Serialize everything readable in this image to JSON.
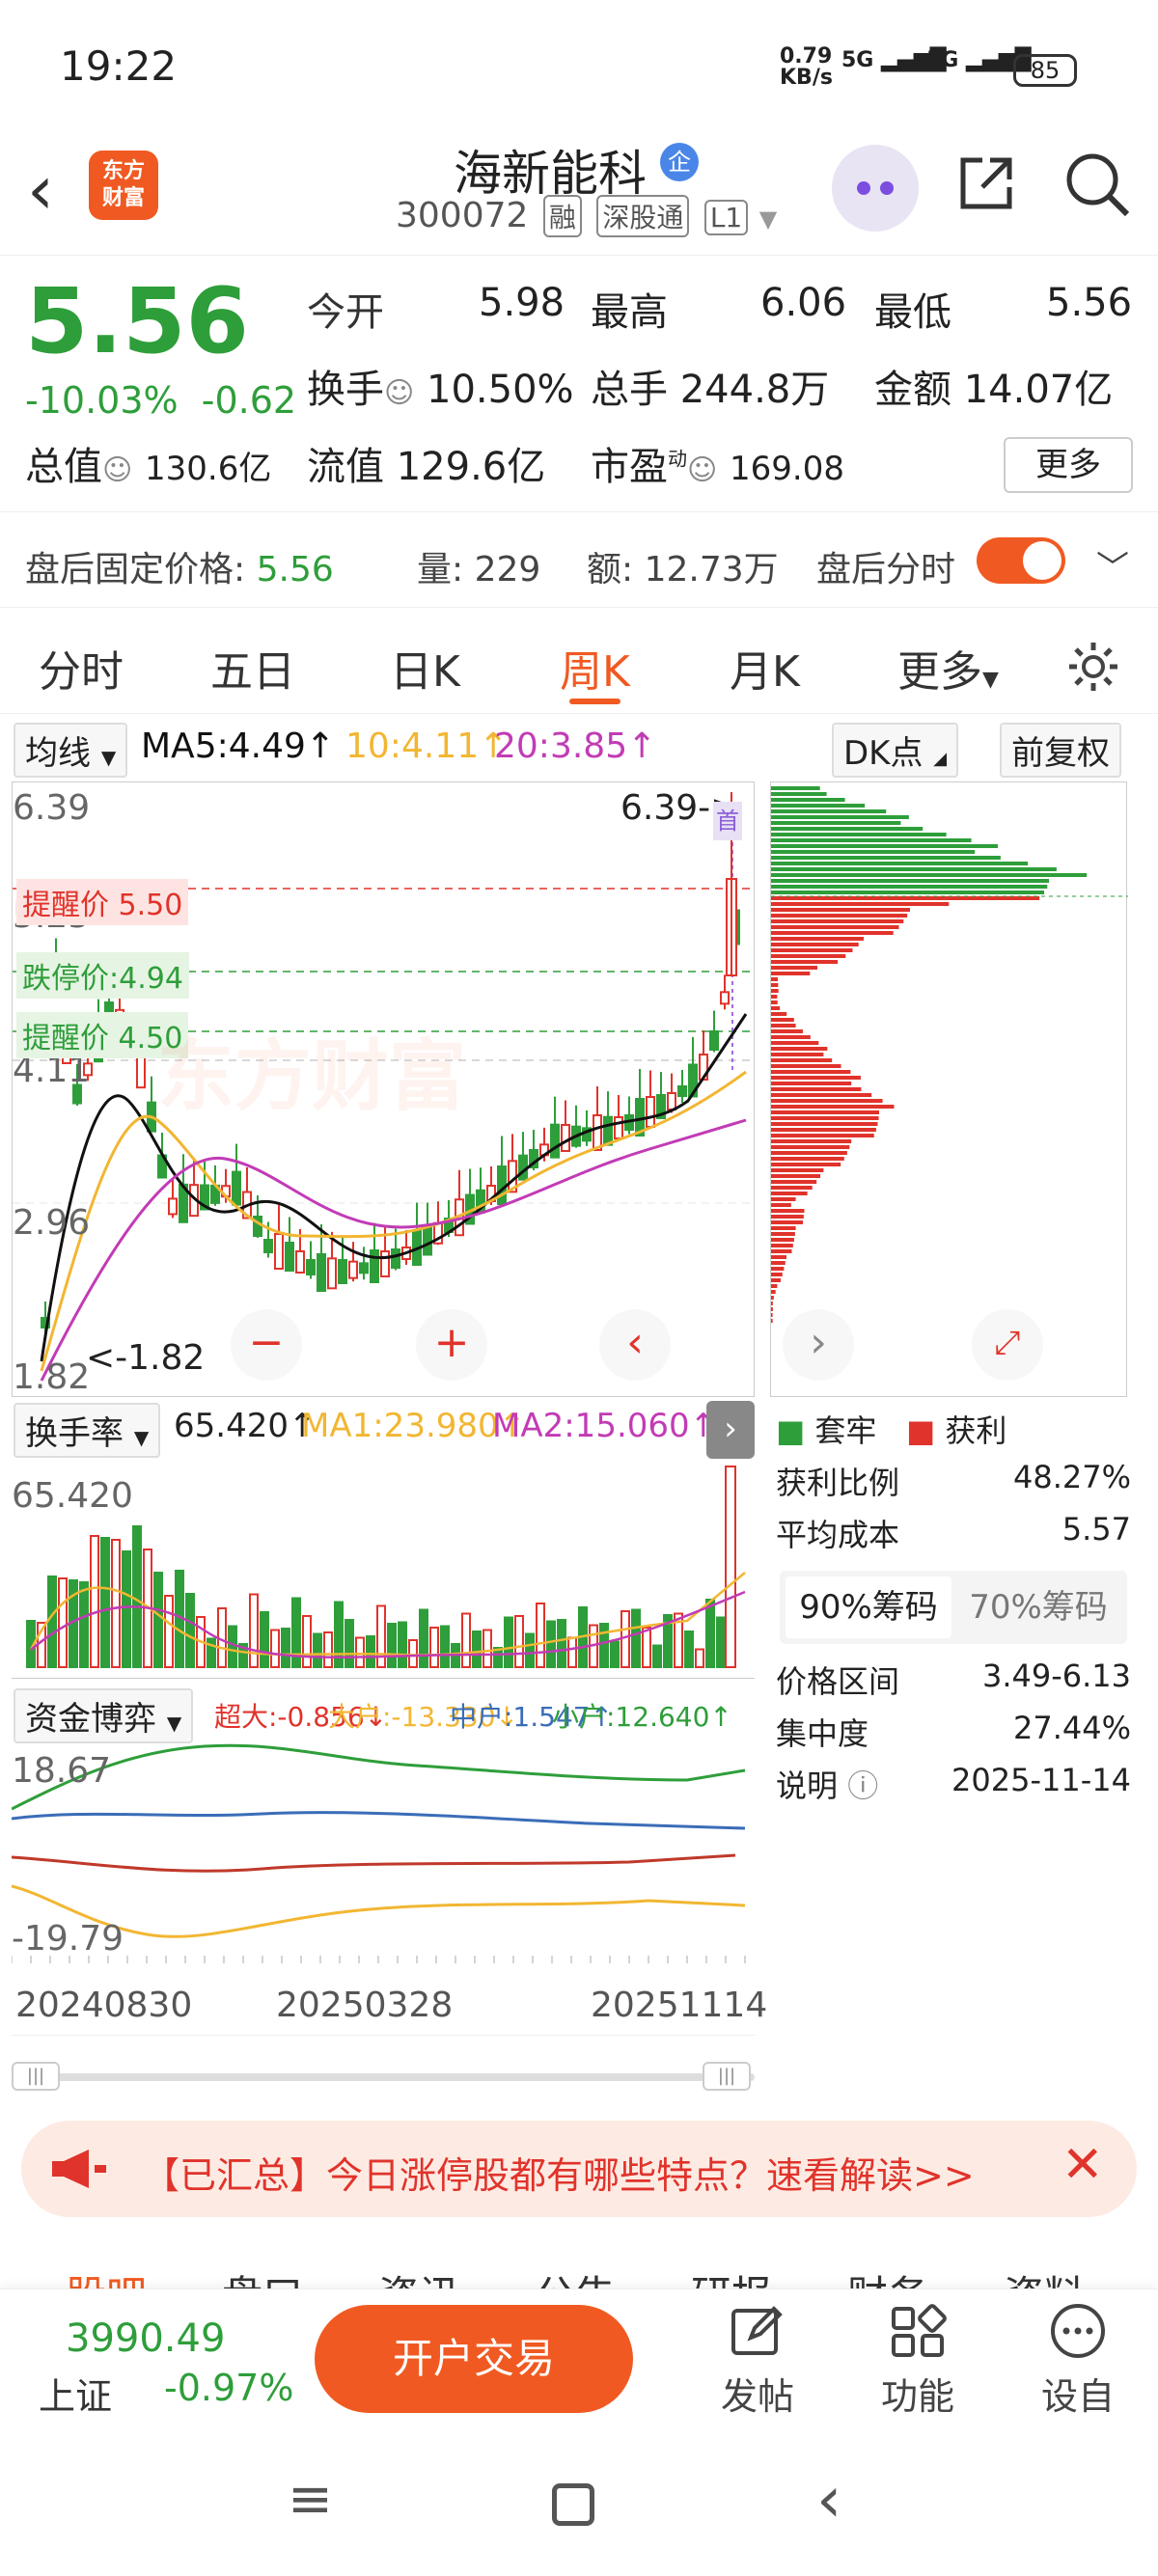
{
  "status": {
    "time": "19:22",
    "net_speed": "0.79",
    "net_unit": "KB/s",
    "sig1": "5G",
    "sig2": "5G",
    "battery": "85"
  },
  "header": {
    "logo_line1": "东方",
    "logo_line2": "财富",
    "stock_name": "海新能科",
    "cert_badge": "企",
    "code": "300072",
    "tags": [
      "融",
      "深股通",
      "L1"
    ]
  },
  "quote": {
    "price": "5.56",
    "pct": "-10.03%",
    "chg": "-0.62",
    "open_label": "今开",
    "open": "5.98",
    "high_label": "最高",
    "high": "6.06",
    "low_label": "最低",
    "low": "5.56",
    "turnover_label": "换手",
    "turnover": "10.50%",
    "volume_label": "总手",
    "volume": "244.8万",
    "amount_label": "金额",
    "amount": "14.07亿",
    "mktcap_label": "总值",
    "mktcap": "130.6亿",
    "float_label": "流值",
    "float": "129.6亿",
    "pe_label": "市盈",
    "pe_sup": "动",
    "pe": "169.08",
    "more": "更多"
  },
  "after_hours": {
    "label": "盘后固定价格:",
    "price": "5.56",
    "vol_label": "量:",
    "vol": "229",
    "amt_label": "额:",
    "amt": "12.73万",
    "timeshare": "盘后分时"
  },
  "period_tabs": [
    "分时",
    "五日",
    "日K",
    "周K",
    "月K",
    "更多"
  ],
  "ma_bar": {
    "select": "均线",
    "ma5": "MA5:4.49",
    "ma10": "10:4.11",
    "ma20": "20:3.85",
    "dk": "DK点",
    "fq": "前复权"
  },
  "kchart": {
    "y_labels": [
      "6.39",
      "5.25",
      "4.11",
      "2.96",
      "1.82"
    ],
    "max_marker": "6.39->",
    "min_marker": "1.82",
    "alerts": [
      {
        "text": "提醒价 5.50"
      },
      {
        "text": "跌停价:4.94"
      },
      {
        "text": "提醒价 4.50"
      }
    ],
    "zoom_out": "−",
    "zoom_in": "+",
    "prev": "‹",
    "next": "›",
    "watermark": "东方财富"
  },
  "turnover": {
    "select": "换手率",
    "value": "65.420",
    "ma1": "MA1:23.980",
    "ma2": "MA2:15.060",
    "y_top": "65.420"
  },
  "fund": {
    "select": "资金博弈",
    "super": "超大:-0.856",
    "big": "大户:-13.330",
    "mid": "中户:1.547",
    "small": "小户:12.640",
    "y_top": "18.67",
    "y_bottom": "-19.79"
  },
  "dates": [
    "20240830",
    "20250328",
    "20251114"
  ],
  "chips": {
    "legend_trap": "套牢",
    "legend_profit": "获利",
    "profit_ratio_label": "获利比例",
    "profit_ratio": "48.27%",
    "avg_cost_label": "平均成本",
    "avg_cost": "5.57",
    "seg_on": "90%筹码",
    "seg_off": "70%筹码",
    "range_label": "价格区间",
    "range": "3.49-6.13",
    "concentration_label": "集中度",
    "concentration": "27.44%",
    "note_label": "说明",
    "note_date": "2025-11-14"
  },
  "banner": {
    "text": "【已汇总】今日涨停股都有哪些特点？速看解读>>"
  },
  "content_tabs": [
    "股吧",
    "盘口",
    "资讯",
    "公告",
    "研报",
    "财务",
    "资料"
  ],
  "bottom": {
    "index_value": "3990.49",
    "index_name": "上证",
    "index_chg": "-0.97%",
    "trade": "开户交易",
    "post": "发帖",
    "func": "功能",
    "watch": "设自选"
  },
  "colors": {
    "up": "#e0332b",
    "down": "#2e9e3a",
    "accent": "#f05a22",
    "ma5": "#111111",
    "ma10": "#f2b632",
    "ma20": "#c23bb5"
  }
}
